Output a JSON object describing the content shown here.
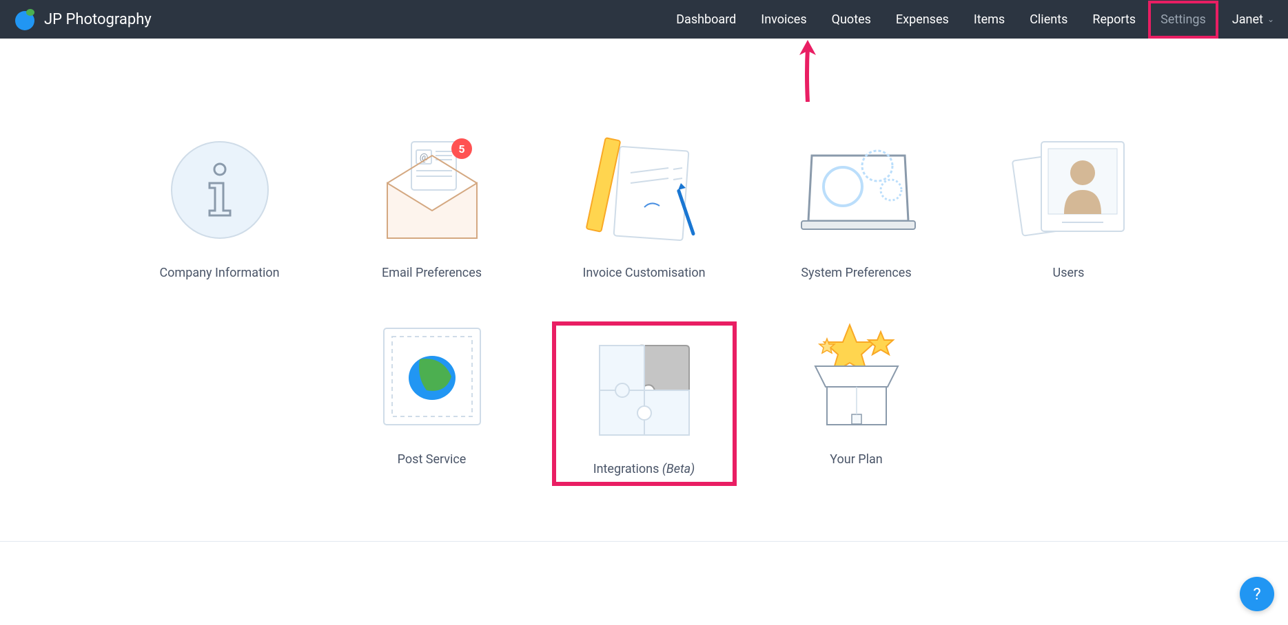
{
  "header": {
    "company_name": "JP Photography",
    "nav": [
      {
        "label": "Dashboard"
      },
      {
        "label": "Invoices"
      },
      {
        "label": "Quotes"
      },
      {
        "label": "Expenses"
      },
      {
        "label": "Items"
      },
      {
        "label": "Clients"
      },
      {
        "label": "Reports"
      },
      {
        "label": "Settings",
        "highlighted": true
      }
    ],
    "user_name": "Janet"
  },
  "tiles_row1": [
    {
      "label": "Company Information",
      "icon": "info"
    },
    {
      "label": "Email Preferences",
      "icon": "email",
      "badge": "5"
    },
    {
      "label": "Invoice Customisation",
      "icon": "invoice"
    },
    {
      "label": "System Preferences",
      "icon": "system"
    },
    {
      "label": "Users",
      "icon": "users"
    }
  ],
  "tiles_row2": [
    {
      "label": "Post Service",
      "icon": "post"
    },
    {
      "label": "Integrations",
      "suffix": "(Beta)",
      "icon": "integrations",
      "highlighted": true
    },
    {
      "label": "Your Plan",
      "icon": "plan"
    }
  ],
  "help": {
    "label": "?"
  }
}
